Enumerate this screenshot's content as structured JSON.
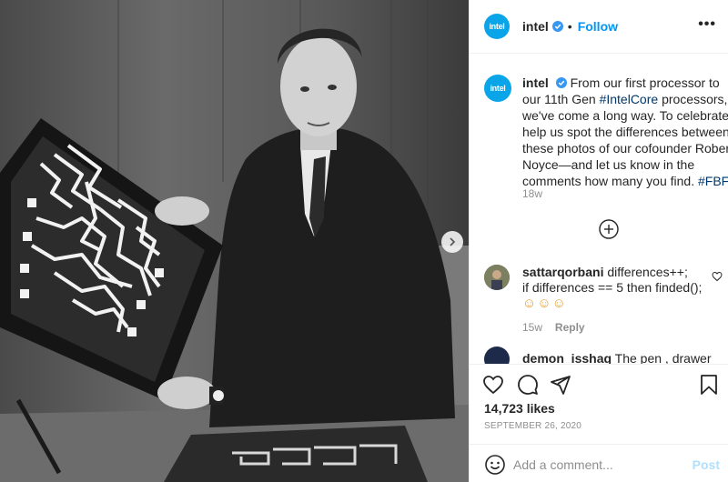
{
  "post": {
    "username": "intel",
    "avatar_text": "intel",
    "follow_label": "Follow",
    "separator": "•",
    "more_label": "•••",
    "caption": {
      "username": "intel",
      "text_before": "From our first processor to our 11th Gen",
      "hashtag1": "#IntelCore",
      "text_middle": "processors, we've come a long way. To celebrate, help us spot the differences between these photos of our cofounder Robert Noyce—and let us know in the comments how many you find.",
      "hashtag2": "#FBF",
      "time": "18w"
    },
    "comments": [
      {
        "username": "sattarqorbani",
        "text_line1": "differences++;",
        "text_line2": "if differences == 5 then finded();",
        "emojis": "☺☺☺",
        "time": "15w",
        "reply_label": "Reply"
      },
      {
        "username": "demon_isshaq",
        "text": "The pen , drawer"
      }
    ],
    "likes": "14,723 likes",
    "date": "SEPTEMBER 26, 2020",
    "comment_placeholder": "Add a comment...",
    "post_label": "Post"
  },
  "colors": {
    "brand": "#0aa5e8",
    "link": "#0095f6",
    "hashtag": "#00376b",
    "muted": "#8e8e8e"
  },
  "icons": [
    "verified-badge-icon",
    "more-options-icon",
    "load-more-comments-icon",
    "heart-icon",
    "comment-icon",
    "share-icon",
    "bookmark-icon",
    "emoji-icon",
    "next-photo-icon"
  ]
}
